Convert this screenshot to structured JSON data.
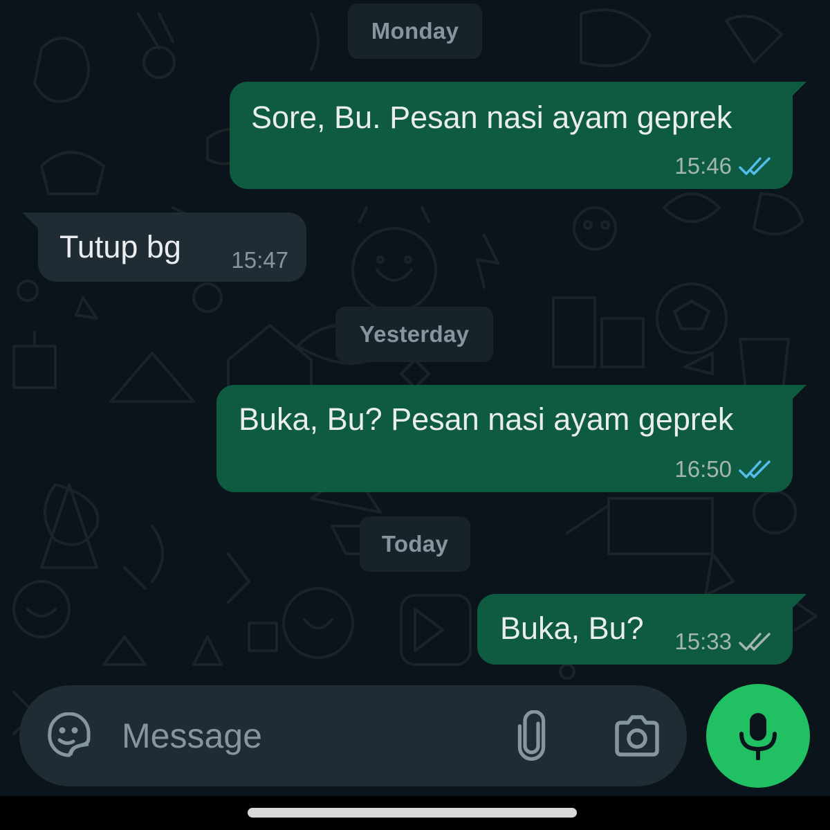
{
  "days": {
    "monday": "Monday",
    "yesterday": "Yesterday",
    "today": "Today"
  },
  "messages": [
    {
      "direction": "out",
      "text": "Sore, Bu. Pesan nasi ayam geprek",
      "time": "15:46",
      "status": "read"
    },
    {
      "direction": "in",
      "text": "Tutup bg",
      "time": "15:47"
    },
    {
      "direction": "out",
      "text": "Buka, Bu? Pesan nasi ayam geprek",
      "time": "16:50",
      "status": "read"
    },
    {
      "direction": "out",
      "text": "Buka, Bu?",
      "time": "15:33",
      "status": "delivered"
    }
  ],
  "composer": {
    "placeholder": "Message",
    "icons": [
      "sticker-icon",
      "paperclip-icon",
      "camera-icon",
      "microphone-icon"
    ]
  },
  "colors": {
    "background": "#0b141a",
    "outgoing_bubble": "#0f5b42",
    "incoming_bubble": "#1f2c34",
    "read_tick": "#53bdeb",
    "delivered_tick": "#a3b6b0",
    "mic_button": "#21c063"
  }
}
